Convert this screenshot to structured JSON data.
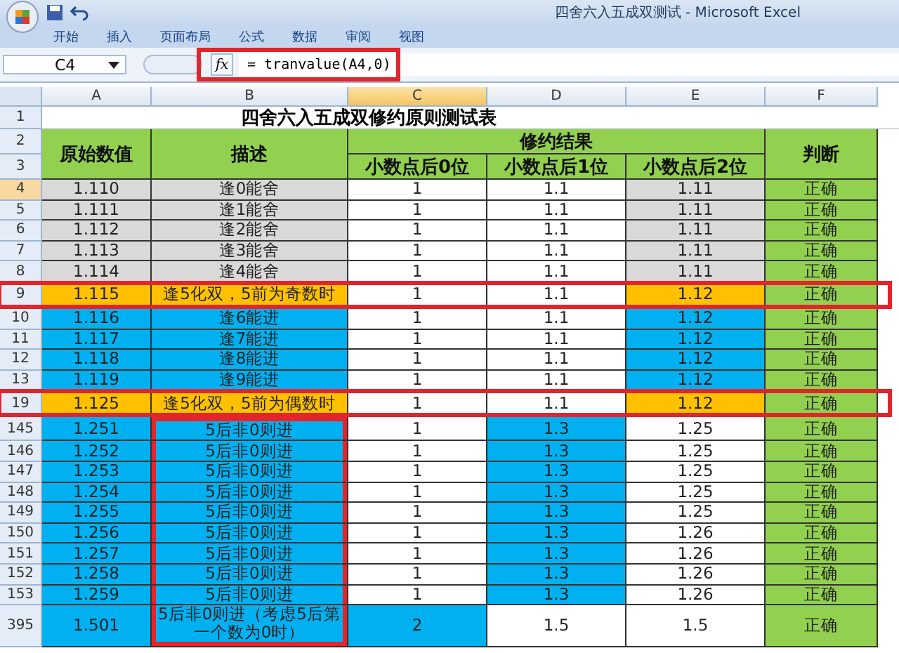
{
  "window": {
    "title": "四舍六入五成双测试 - Microsoft Excel"
  },
  "ribbon_tabs": [
    "开始",
    "插入",
    "页面布局",
    "公式",
    "数据",
    "审阅",
    "视图"
  ],
  "formula_bar": {
    "name_box": "C4",
    "function_label": "fx",
    "formula": "= tranvalue(A4,0)",
    "outlined": true
  },
  "table": {
    "columns": [
      {
        "label": "A",
        "selected": false
      },
      {
        "label": "B",
        "selected": false
      },
      {
        "label": "C",
        "selected": true
      },
      {
        "label": "D",
        "selected": false
      },
      {
        "label": "E",
        "selected": false
      },
      {
        "label": "F",
        "selected": false
      }
    ],
    "title_row": {
      "num": "1",
      "title": "四舍六入五成双修约原则测试表"
    },
    "header": {
      "row_nums": [
        "2",
        "3"
      ],
      "original": "原始数值",
      "description": "描述",
      "result": "修约结果",
      "sub": [
        "小数点后0位",
        "小数点后1位",
        "小数点后2位"
      ],
      "judgement": "判断"
    },
    "rows": [
      {
        "num": "4",
        "selected": true,
        "outlined": false,
        "desc_outlined": false,
        "cells": [
          {
            "text": "1.110",
            "color": "#d9d9d9"
          },
          {
            "text": "逢0能舍",
            "color": "#d9d9d9"
          },
          {
            "text": "1",
            "color": "#ffffff"
          },
          {
            "text": "1.1",
            "color": "#ffffff"
          },
          {
            "text": "1.11",
            "color": "#d9d9d9"
          },
          {
            "text": "正确",
            "color": "#92d050"
          }
        ]
      },
      {
        "num": "5",
        "selected": false,
        "outlined": false,
        "desc_outlined": false,
        "cells": [
          {
            "text": "1.111",
            "color": "#d9d9d9"
          },
          {
            "text": "逢1能舍",
            "color": "#d9d9d9"
          },
          {
            "text": "1",
            "color": "#ffffff"
          },
          {
            "text": "1.1",
            "color": "#ffffff"
          },
          {
            "text": "1.11",
            "color": "#d9d9d9"
          },
          {
            "text": "正确",
            "color": "#92d050"
          }
        ]
      },
      {
        "num": "6",
        "selected": false,
        "outlined": false,
        "desc_outlined": false,
        "cells": [
          {
            "text": "1.112",
            "color": "#d9d9d9"
          },
          {
            "text": "逢2能舍",
            "color": "#d9d9d9"
          },
          {
            "text": "1",
            "color": "#ffffff"
          },
          {
            "text": "1.1",
            "color": "#ffffff"
          },
          {
            "text": "1.11",
            "color": "#d9d9d9"
          },
          {
            "text": "正确",
            "color": "#92d050"
          }
        ]
      },
      {
        "num": "7",
        "selected": false,
        "outlined": false,
        "desc_outlined": false,
        "cells": [
          {
            "text": "1.113",
            "color": "#d9d9d9"
          },
          {
            "text": "逢3能舍",
            "color": "#d9d9d9"
          },
          {
            "text": "1",
            "color": "#ffffff"
          },
          {
            "text": "1.1",
            "color": "#ffffff"
          },
          {
            "text": "1.11",
            "color": "#d9d9d9"
          },
          {
            "text": "正确",
            "color": "#92d050"
          }
        ]
      },
      {
        "num": "8",
        "selected": false,
        "outlined": false,
        "desc_outlined": false,
        "cells": [
          {
            "text": "1.114",
            "color": "#d9d9d9"
          },
          {
            "text": "逢4能舍",
            "color": "#d9d9d9"
          },
          {
            "text": "1",
            "color": "#ffffff"
          },
          {
            "text": "1.1",
            "color": "#ffffff"
          },
          {
            "text": "1.11",
            "color": "#d9d9d9"
          },
          {
            "text": "正确",
            "color": "#92d050"
          }
        ]
      },
      {
        "num": "9",
        "selected": false,
        "outlined": true,
        "desc_outlined": false,
        "cells": [
          {
            "text": "1.115",
            "color": "#ffc000"
          },
          {
            "text": "逢5化双，5前为奇数时",
            "color": "#ffc000"
          },
          {
            "text": "1",
            "color": "#ffffff"
          },
          {
            "text": "1.1",
            "color": "#ffffff"
          },
          {
            "text": "1.12",
            "color": "#ffc000"
          },
          {
            "text": "正确",
            "color": "#92d050"
          }
        ]
      },
      {
        "num": "10",
        "selected": false,
        "outlined": false,
        "desc_outlined": false,
        "cells": [
          {
            "text": "1.116",
            "color": "#00b0f0"
          },
          {
            "text": "逢6能进",
            "color": "#00b0f0"
          },
          {
            "text": "1",
            "color": "#ffffff"
          },
          {
            "text": "1.1",
            "color": "#ffffff"
          },
          {
            "text": "1.12",
            "color": "#00b0f0"
          },
          {
            "text": "正确",
            "color": "#92d050"
          }
        ]
      },
      {
        "num": "11",
        "selected": false,
        "outlined": false,
        "desc_outlined": false,
        "cells": [
          {
            "text": "1.117",
            "color": "#00b0f0"
          },
          {
            "text": "逢7能进",
            "color": "#00b0f0"
          },
          {
            "text": "1",
            "color": "#ffffff"
          },
          {
            "text": "1.1",
            "color": "#ffffff"
          },
          {
            "text": "1.12",
            "color": "#00b0f0"
          },
          {
            "text": "正确",
            "color": "#92d050"
          }
        ]
      },
      {
        "num": "12",
        "selected": false,
        "outlined": false,
        "desc_outlined": false,
        "cells": [
          {
            "text": "1.118",
            "color": "#00b0f0"
          },
          {
            "text": "逢8能进",
            "color": "#00b0f0"
          },
          {
            "text": "1",
            "color": "#ffffff"
          },
          {
            "text": "1.1",
            "color": "#ffffff"
          },
          {
            "text": "1.12",
            "color": "#00b0f0"
          },
          {
            "text": "正确",
            "color": "#92d050"
          }
        ]
      },
      {
        "num": "13",
        "selected": false,
        "outlined": false,
        "desc_outlined": false,
        "cells": [
          {
            "text": "1.119",
            "color": "#00b0f0"
          },
          {
            "text": "逢9能进",
            "color": "#00b0f0"
          },
          {
            "text": "1",
            "color": "#ffffff"
          },
          {
            "text": "1.1",
            "color": "#ffffff"
          },
          {
            "text": "1.12",
            "color": "#00b0f0"
          },
          {
            "text": "正确",
            "color": "#92d050"
          }
        ]
      },
      {
        "num": "19",
        "selected": false,
        "outlined": true,
        "desc_outlined": false,
        "cells": [
          {
            "text": "1.125",
            "color": "#ffc000"
          },
          {
            "text": "逢5化双，5前为偶数时",
            "color": "#ffc000"
          },
          {
            "text": "1",
            "color": "#ffffff"
          },
          {
            "text": "1.1",
            "color": "#ffffff"
          },
          {
            "text": "1.12",
            "color": "#ffc000"
          },
          {
            "text": "正确",
            "color": "#92d050"
          }
        ]
      },
      {
        "num": "145",
        "selected": false,
        "outlined": false,
        "desc_outlined": true,
        "cells": [
          {
            "text": "1.251",
            "color": "#00b0f0"
          },
          {
            "text": "5后非0则进",
            "color": "#00b0f0"
          },
          {
            "text": "1",
            "color": "#ffffff"
          },
          {
            "text": "1.3",
            "color": "#00b0f0"
          },
          {
            "text": "1.25",
            "color": "#ffffff"
          },
          {
            "text": "正确",
            "color": "#92d050"
          }
        ]
      },
      {
        "num": "146",
        "selected": false,
        "outlined": false,
        "desc_outlined": true,
        "cells": [
          {
            "text": "1.252",
            "color": "#00b0f0"
          },
          {
            "text": "5后非0则进",
            "color": "#00b0f0"
          },
          {
            "text": "1",
            "color": "#ffffff"
          },
          {
            "text": "1.3",
            "color": "#00b0f0"
          },
          {
            "text": "1.25",
            "color": "#ffffff"
          },
          {
            "text": "正确",
            "color": "#92d050"
          }
        ]
      },
      {
        "num": "147",
        "selected": false,
        "outlined": false,
        "desc_outlined": true,
        "cells": [
          {
            "text": "1.253",
            "color": "#00b0f0"
          },
          {
            "text": "5后非0则进",
            "color": "#00b0f0"
          },
          {
            "text": "1",
            "color": "#ffffff"
          },
          {
            "text": "1.3",
            "color": "#00b0f0"
          },
          {
            "text": "1.25",
            "color": "#ffffff"
          },
          {
            "text": "正确",
            "color": "#92d050"
          }
        ]
      },
      {
        "num": "148",
        "selected": false,
        "outlined": false,
        "desc_outlined": true,
        "cells": [
          {
            "text": "1.254",
            "color": "#00b0f0"
          },
          {
            "text": "5后非0则进",
            "color": "#00b0f0"
          },
          {
            "text": "1",
            "color": "#ffffff"
          },
          {
            "text": "1.3",
            "color": "#00b0f0"
          },
          {
            "text": "1.25",
            "color": "#ffffff"
          },
          {
            "text": "正确",
            "color": "#92d050"
          }
        ]
      },
      {
        "num": "149",
        "selected": false,
        "outlined": false,
        "desc_outlined": true,
        "cells": [
          {
            "text": "1.255",
            "color": "#00b0f0"
          },
          {
            "text": "5后非0则进",
            "color": "#00b0f0"
          },
          {
            "text": "1",
            "color": "#ffffff"
          },
          {
            "text": "1.3",
            "color": "#00b0f0"
          },
          {
            "text": "1.25",
            "color": "#ffffff"
          },
          {
            "text": "正确",
            "color": "#92d050"
          }
        ]
      },
      {
        "num": "150",
        "selected": false,
        "outlined": false,
        "desc_outlined": true,
        "cells": [
          {
            "text": "1.256",
            "color": "#00b0f0"
          },
          {
            "text": "5后非0则进",
            "color": "#00b0f0"
          },
          {
            "text": "1",
            "color": "#ffffff"
          },
          {
            "text": "1.3",
            "color": "#00b0f0"
          },
          {
            "text": "1.26",
            "color": "#ffffff"
          },
          {
            "text": "正确",
            "color": "#92d050"
          }
        ]
      },
      {
        "num": "151",
        "selected": false,
        "outlined": false,
        "desc_outlined": true,
        "cells": [
          {
            "text": "1.257",
            "color": "#00b0f0"
          },
          {
            "text": "5后非0则进",
            "color": "#00b0f0"
          },
          {
            "text": "1",
            "color": "#ffffff"
          },
          {
            "text": "1.3",
            "color": "#00b0f0"
          },
          {
            "text": "1.26",
            "color": "#ffffff"
          },
          {
            "text": "正确",
            "color": "#92d050"
          }
        ]
      },
      {
        "num": "152",
        "selected": false,
        "outlined": false,
        "desc_outlined": true,
        "cells": [
          {
            "text": "1.258",
            "color": "#00b0f0"
          },
          {
            "text": "5后非0则进",
            "color": "#00b0f0"
          },
          {
            "text": "1",
            "color": "#ffffff"
          },
          {
            "text": "1.3",
            "color": "#00b0f0"
          },
          {
            "text": "1.26",
            "color": "#ffffff"
          },
          {
            "text": "正确",
            "color": "#92d050"
          }
        ]
      },
      {
        "num": "153",
        "selected": false,
        "outlined": false,
        "desc_outlined": true,
        "cells": [
          {
            "text": "1.259",
            "color": "#00b0f0"
          },
          {
            "text": "5后非0则进",
            "color": "#00b0f0"
          },
          {
            "text": "1",
            "color": "#ffffff"
          },
          {
            "text": "1.3",
            "color": "#00b0f0"
          },
          {
            "text": "1.26",
            "color": "#ffffff"
          },
          {
            "text": "正确",
            "color": "#92d050"
          }
        ]
      },
      {
        "num": "395",
        "selected": false,
        "outlined": false,
        "desc_outlined": true,
        "cells": [
          {
            "text": "1.501",
            "color": "#00b0f0"
          },
          {
            "text": "5后非0则进（考虑5后第一个数为0时）",
            "color": "#00b0f0"
          },
          {
            "text": "2",
            "color": "#00b0f0"
          },
          {
            "text": "1.5",
            "color": "#ffffff"
          },
          {
            "text": "1.5",
            "color": "#ffffff"
          },
          {
            "text": "正确",
            "color": "#92d050"
          }
        ]
      }
    ]
  }
}
